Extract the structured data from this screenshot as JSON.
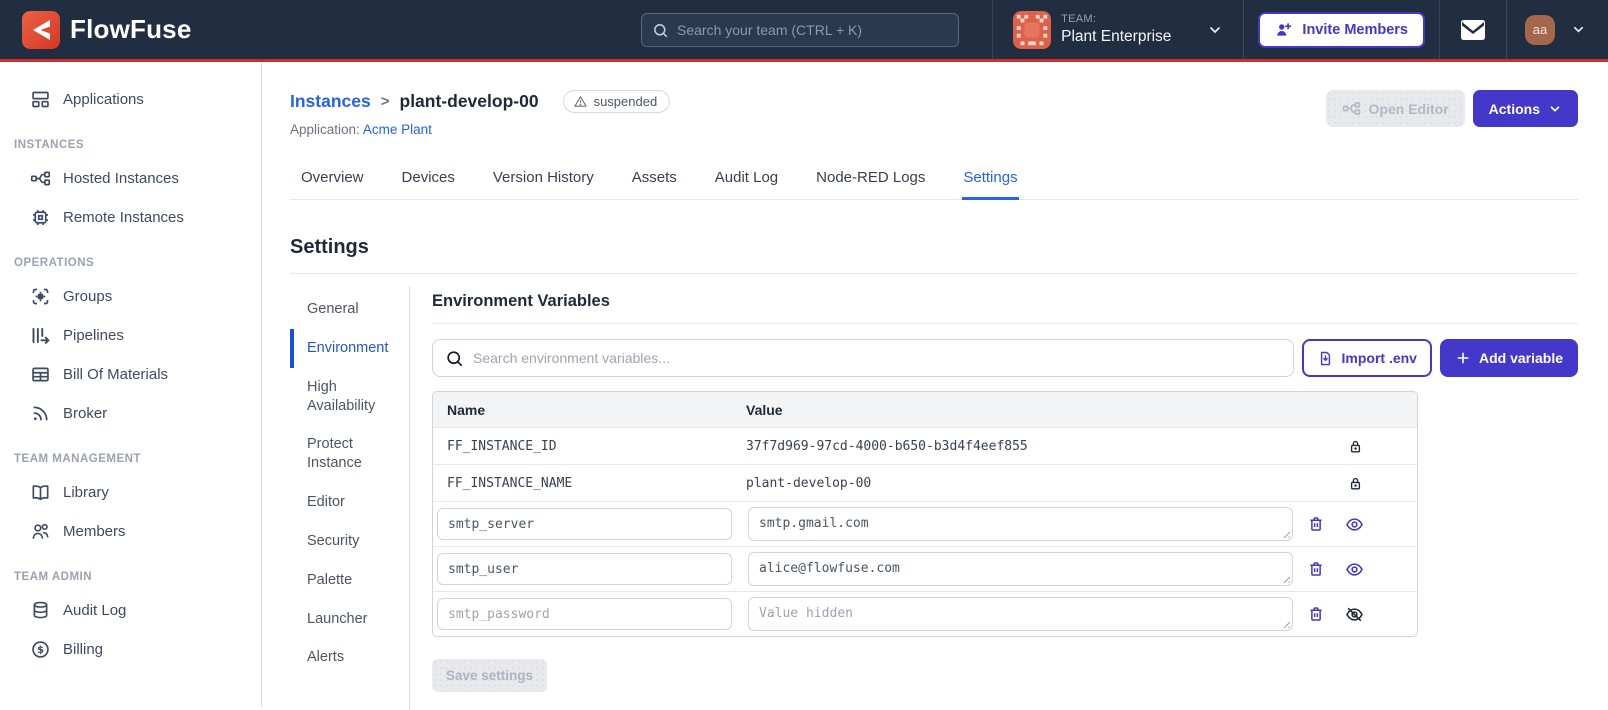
{
  "theme": {
    "navbar_bg": "#212d40",
    "accent_red": "#d22b2b",
    "indigo": "#4338ca",
    "link_blue": "#2563eb",
    "team_avatar_color": "#e0614a",
    "user_avatar_color": "#a5674c"
  },
  "navbar": {
    "brand": "FlowFuse",
    "search_placeholder": "Search your team (CTRL + K)",
    "team_label": "TEAM:",
    "team_name": "Plant Enterprise",
    "invite_label": "Invite Members",
    "avatar_initials": "aa"
  },
  "sidebar": {
    "sections": [
      {
        "header": "",
        "items": [
          {
            "label": "Applications"
          }
        ]
      },
      {
        "header": "INSTANCES",
        "items": [
          {
            "label": "Hosted Instances"
          },
          {
            "label": "Remote Instances"
          }
        ]
      },
      {
        "header": "OPERATIONS",
        "items": [
          {
            "label": "Groups"
          },
          {
            "label": "Pipelines"
          },
          {
            "label": "Bill Of Materials"
          },
          {
            "label": "Broker"
          }
        ]
      },
      {
        "header": "TEAM MANAGEMENT",
        "items": [
          {
            "label": "Library"
          },
          {
            "label": "Members"
          }
        ]
      },
      {
        "header": "TEAM ADMIN",
        "items": [
          {
            "label": "Audit Log"
          },
          {
            "label": "Billing"
          }
        ]
      }
    ]
  },
  "header": {
    "breadcrumb_parent": "Instances",
    "breadcrumb_sep": ">",
    "breadcrumb_current": "plant-develop-00",
    "status_badge": "suspended",
    "application_label": "Application:",
    "application_name": "Acme Plant",
    "open_editor_label": "Open Editor",
    "actions_label": "Actions"
  },
  "tabs": {
    "items": [
      {
        "label": "Overview"
      },
      {
        "label": "Devices"
      },
      {
        "label": "Version History"
      },
      {
        "label": "Assets"
      },
      {
        "label": "Audit Log"
      },
      {
        "label": "Node-RED Logs"
      },
      {
        "label": "Settings"
      }
    ],
    "active": "Settings"
  },
  "settings": {
    "title": "Settings",
    "nav": {
      "items": [
        {
          "label": "General"
        },
        {
          "label": "Environment"
        },
        {
          "label": "High Availability"
        },
        {
          "label": "Protect Instance"
        },
        {
          "label": "Editor"
        },
        {
          "label": "Security"
        },
        {
          "label": "Palette"
        },
        {
          "label": "Launcher"
        },
        {
          "label": "Alerts"
        }
      ],
      "active": "Environment"
    },
    "panel": {
      "title": "Environment Variables",
      "search_placeholder": "Search environment variables...",
      "import_label": "Import .env",
      "add_label": "Add variable",
      "save_label": "Save settings",
      "table": {
        "columns": {
          "name": "Name",
          "value": "Value"
        },
        "locked_rows": [
          {
            "name": "FF_INSTANCE_ID",
            "value": "37f7d969-97cd-4000-b650-b3d4f4eef855"
          },
          {
            "name": "FF_INSTANCE_NAME",
            "value": "plant-develop-00"
          }
        ],
        "editable_rows": [
          {
            "name": "smtp_server",
            "value": "smtp.gmail.com",
            "value_placeholder": ""
          },
          {
            "name": "smtp_user",
            "value": "alice@flowfuse.com",
            "value_placeholder": ""
          },
          {
            "name": "smtp_password",
            "value": "",
            "value_placeholder": "Value hidden"
          }
        ]
      }
    }
  }
}
